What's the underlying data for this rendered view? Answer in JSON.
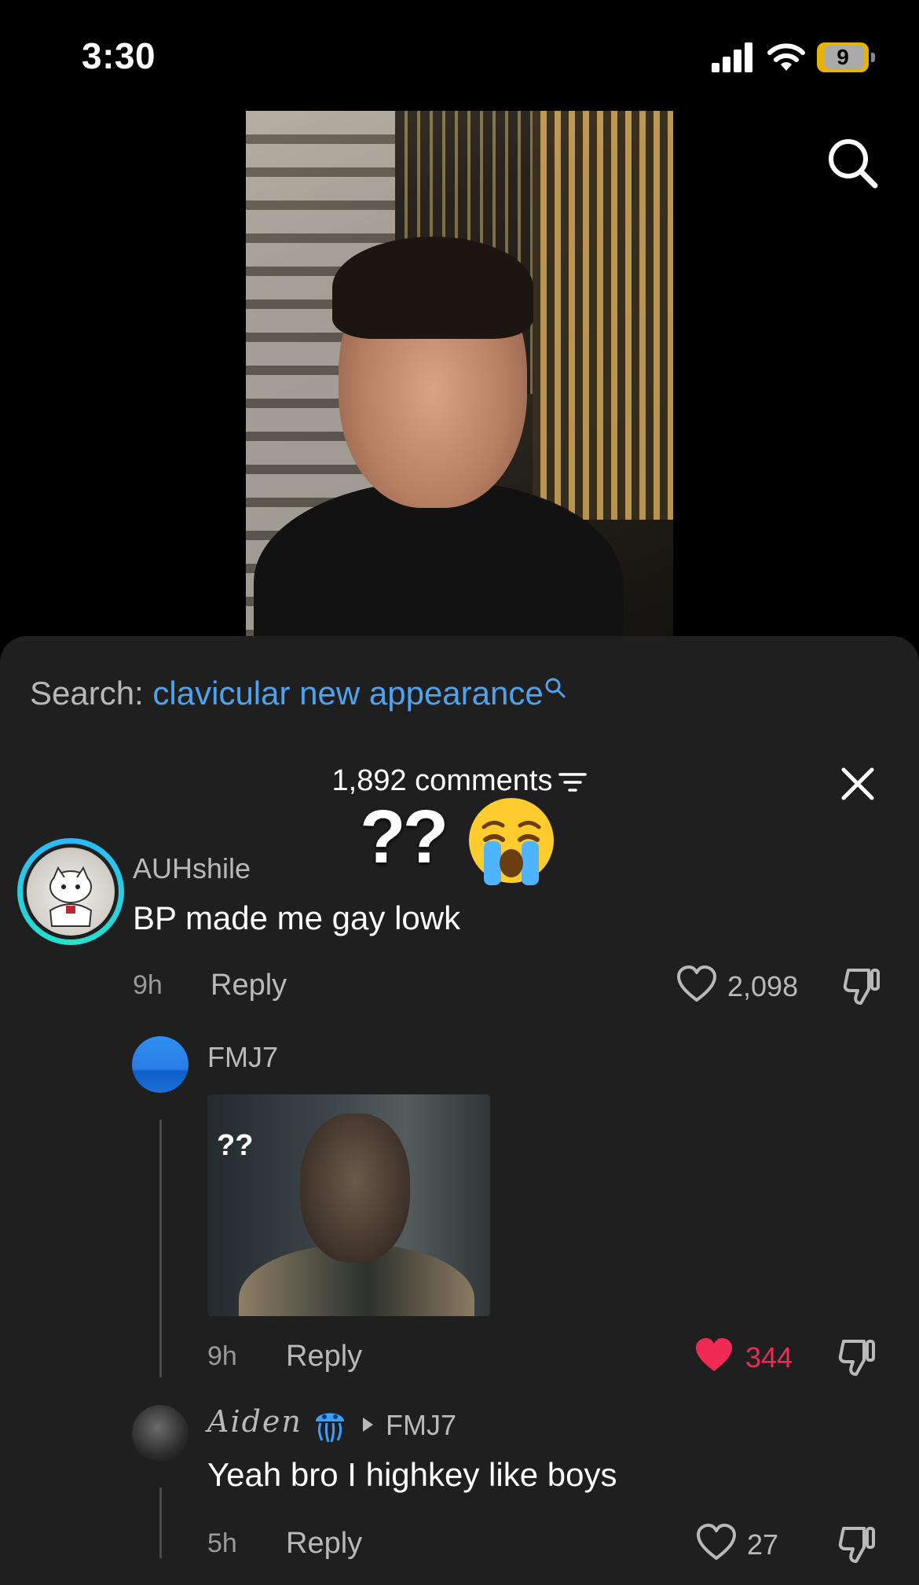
{
  "status_bar": {
    "time": "3:30",
    "battery": "9"
  },
  "search_suggestion": {
    "label": "Search:",
    "query": "clavicular new appearance"
  },
  "comments": {
    "count_label": "1,892 comments"
  },
  "sticker": {
    "text": "??"
  },
  "thread": {
    "main": {
      "username": "AUHshile",
      "text": "BP made me gay lowk",
      "time": "9h",
      "reply_label": "Reply",
      "likes": "2,098",
      "liked": false
    },
    "replies": [
      {
        "username": "FMJ7",
        "gif_text": "??",
        "time": "9h",
        "reply_label": "Reply",
        "likes": "344",
        "liked": true
      },
      {
        "username": "Aiden",
        "reply_to": "FMJ7",
        "text": "Yeah bro I highkey like boys",
        "time": "5h",
        "reply_label": "Reply",
        "likes": "27",
        "liked": false
      }
    ]
  },
  "colors": {
    "accent_blue": "#4fa3ee",
    "like_red": "#ee2a55",
    "sheet_bg": "#1f1f1f",
    "battery_yellow": "#e6b300"
  },
  "icons": [
    "signal-icon",
    "wifi-icon",
    "battery-icon",
    "search-icon",
    "filter-icon",
    "close-icon",
    "heart-icon",
    "dislike-icon",
    "jellyfish-emoji-icon",
    "crying-emoji-icon"
  ]
}
